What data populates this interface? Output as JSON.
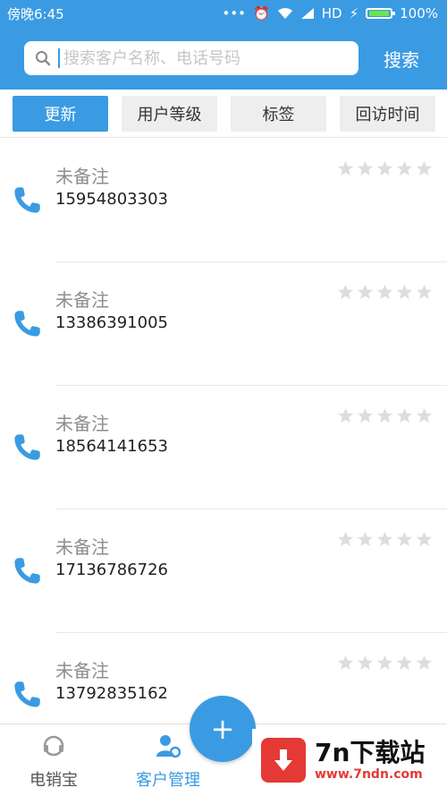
{
  "statusbar": {
    "time": "傍晚6:45",
    "network": "HD",
    "battery": "100%"
  },
  "search": {
    "placeholder": "搜索客户名称、电话号码",
    "button_label": "搜索"
  },
  "filters": [
    {
      "label": "更新",
      "active": true
    },
    {
      "label": "用户等级",
      "active": false
    },
    {
      "label": "标签",
      "active": false
    },
    {
      "label": "回访时间",
      "active": false
    }
  ],
  "contacts": [
    {
      "note": "未备注",
      "phone": "15954803303",
      "rating": 0
    },
    {
      "note": "未备注",
      "phone": "13386391005",
      "rating": 0
    },
    {
      "note": "未备注",
      "phone": "18564141653",
      "rating": 0
    },
    {
      "note": "未备注",
      "phone": "17136786726",
      "rating": 0
    },
    {
      "note": "未备注",
      "phone": "13792835162",
      "rating": 0
    }
  ],
  "bottomnav": {
    "item1_label": "电销宝",
    "item2_label": "客户管理",
    "fab_label": "+"
  },
  "watermark": {
    "title": "7n下载站",
    "url": "www.7ndn.com"
  },
  "colors": {
    "accent": "#3a9be3",
    "star_empty": "#dddddd",
    "watermark_red": "#e53935"
  }
}
